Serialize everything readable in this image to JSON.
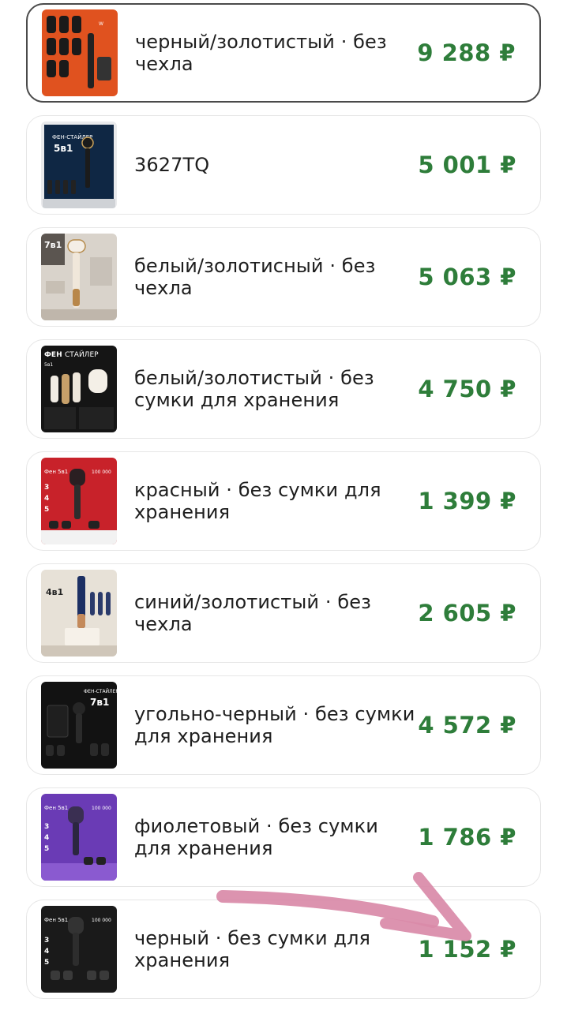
{
  "currency_symbol": "₽",
  "accent_price_color": "#2e7d3a",
  "variants": [
    {
      "label": "черный/золотистый · без чехла",
      "price": "9 288 ₽",
      "selected": true,
      "thumb_icon": "hair-styler-orange-box-image"
    },
    {
      "label": "3627TQ",
      "price": "5 001 ₽",
      "selected": false,
      "thumb_icon": "hair-styler-navy-box-image"
    },
    {
      "label": "белый/золотисный · без чехла",
      "price": "5 063 ₽",
      "selected": false,
      "thumb_icon": "hair-styler-white-gold-image"
    },
    {
      "label": "белый/золотистый · без сумки для хранения",
      "price": "4 750 ₽",
      "selected": false,
      "thumb_icon": "hair-styler-white-black-box-image"
    },
    {
      "label": "красный · без сумки для хранения",
      "price": "1 399 ₽",
      "selected": false,
      "thumb_icon": "hair-dryer-red-image"
    },
    {
      "label": "синий/золотистый · без чехла",
      "price": "2 605 ₽",
      "selected": false,
      "thumb_icon": "hair-styler-blue-gold-image"
    },
    {
      "label": "угольно-черный · без сумки для хранения",
      "price": "4 572 ₽",
      "selected": false,
      "thumb_icon": "hair-styler-charcoal-image"
    },
    {
      "label": "фиолетовый · без сумки для хранения",
      "price": "1 786 ₽",
      "selected": false,
      "thumb_icon": "hair-dryer-purple-image"
    },
    {
      "label": "черный · без сумки для хранения",
      "price": "1 152 ₽",
      "selected": false,
      "thumb_icon": "hair-dryer-black-image"
    }
  ],
  "annotation": {
    "type": "pink-arrow",
    "color": "#d98aa8",
    "points_to": "variant-8-price"
  }
}
